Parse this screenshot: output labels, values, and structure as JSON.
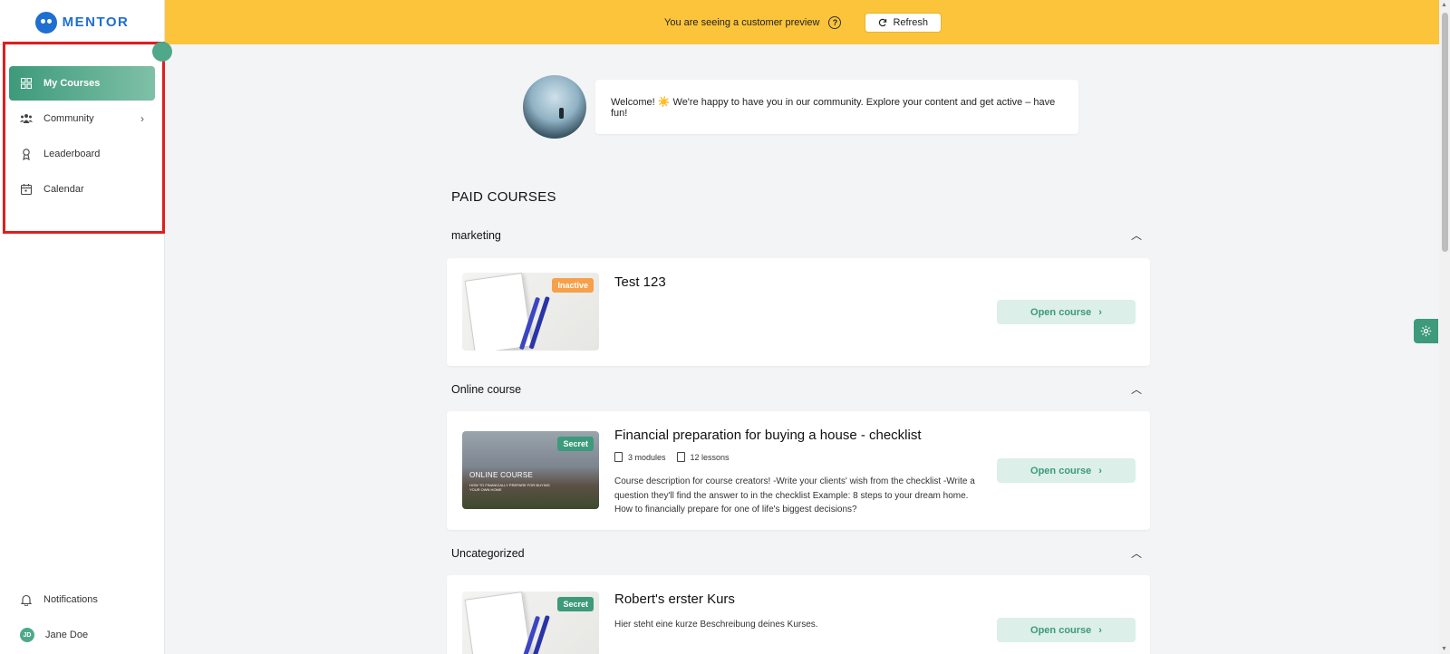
{
  "brand": {
    "name": "MENTOR"
  },
  "banner": {
    "message": "You are seeing a customer preview",
    "help_icon": "question-circle-icon",
    "refresh_label": "Refresh",
    "color": "#fbc43a"
  },
  "sidebar": {
    "items": [
      {
        "label": "My Courses",
        "icon": "grid-icon",
        "active": true
      },
      {
        "label": "Community",
        "icon": "people-icon",
        "has_submenu": true
      },
      {
        "label": "Leaderboard",
        "icon": "trophy-icon"
      },
      {
        "label": "Calendar",
        "icon": "calendar-icon"
      }
    ],
    "bottom": {
      "notifications_label": "Notifications",
      "user_initials": "JD",
      "user_name": "Jane Doe"
    }
  },
  "welcome": {
    "message": "Welcome! ☀️ We're happy to have you in our community. Explore your content and get active – have fun!"
  },
  "main": {
    "section_title": "PAID COURSES",
    "open_course_label": "Open course",
    "categories": [
      {
        "name": "marketing",
        "courses": [
          {
            "title": "Test 123",
            "badge": "Inactive"
          }
        ]
      },
      {
        "name": "Online course",
        "courses": [
          {
            "title": "Financial preparation for buying a house - checklist",
            "badge": "Secret",
            "modules": "3 modules",
            "lessons": "12 lessons",
            "thumb_text": "ONLINE COURSE",
            "thumb_subtext": "HOW TO FINANCIALLY PREPARE FOR BUYING YOUR OWN HOME",
            "description": "Course description for course creators! -Write your clients' wish from the checklist -Write a question they'll find the answer to in the checklist Example: 8 steps to your dream home. How to financially prepare for one of life's biggest decisions?"
          }
        ]
      },
      {
        "name": "Uncategorized",
        "courses": [
          {
            "title": "Robert's erster Kurs",
            "badge": "Secret",
            "description": "Hier steht eine kurze Beschreibung deines Kurses."
          }
        ]
      }
    ]
  },
  "colors": {
    "accent": "#3d9a7b",
    "highlight": "#e11d1d",
    "inactive": "#f6a04a"
  }
}
